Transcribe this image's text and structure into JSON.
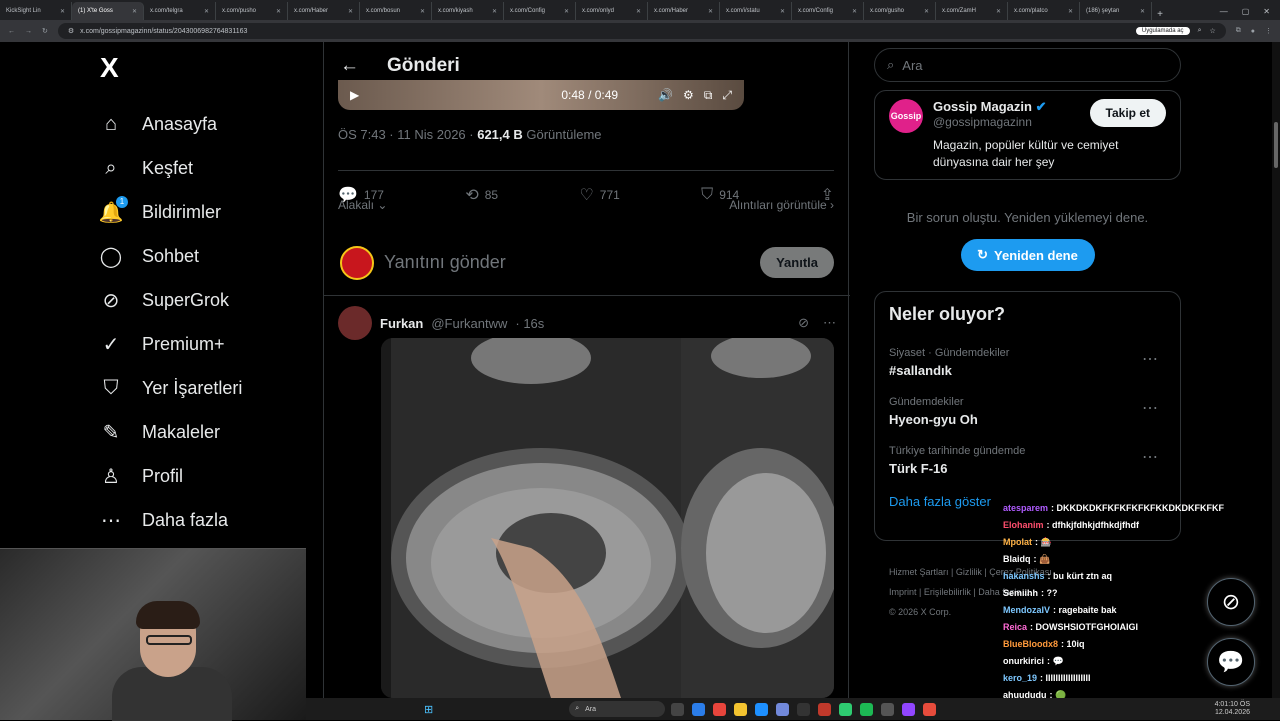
{
  "browser": {
    "tabs": [
      {
        "label": "KickSight Lin",
        "active": false
      },
      {
        "label": "(1) X'te Goss",
        "active": true
      },
      {
        "label": "x.com/telgra",
        "active": false
      },
      {
        "label": "x.com/pusho",
        "active": false
      },
      {
        "label": "x.com/Haber",
        "active": false
      },
      {
        "label": "x.com/bosun",
        "active": false
      },
      {
        "label": "x.com/kiyash",
        "active": false
      },
      {
        "label": "x.com/Config",
        "active": false
      },
      {
        "label": "x.com/onlyd",
        "active": false
      },
      {
        "label": "x.com/Haber",
        "active": false
      },
      {
        "label": "x.com/i/statu",
        "active": false
      },
      {
        "label": "x.com/Config",
        "active": false
      },
      {
        "label": "x.com/gusho",
        "active": false
      },
      {
        "label": "x.com/ZamH",
        "active": false
      },
      {
        "label": "x.com/platco",
        "active": false
      },
      {
        "label": "(186) şeytan",
        "active": false
      }
    ],
    "url": "x.com/gossipmagazinn/status/2043006982764831163",
    "open_in_app": "Uygulamada aç"
  },
  "nav": {
    "logo": "X",
    "items": [
      {
        "label": "Anasayfa",
        "icon": "home-icon",
        "glyph": "⌂"
      },
      {
        "label": "Keşfet",
        "icon": "search-icon",
        "glyph": "⌕"
      },
      {
        "label": "Bildirimler",
        "icon": "bell-icon",
        "glyph": "🔔",
        "badge": "1"
      },
      {
        "label": "Sohbet",
        "icon": "chat-icon",
        "glyph": "◯"
      },
      {
        "label": "SuperGrok",
        "icon": "grok-icon",
        "glyph": "⊘"
      },
      {
        "label": "Premium+",
        "icon": "premium-icon",
        "glyph": "✓"
      },
      {
        "label": "Yer İşaretleri",
        "icon": "bookmark-icon",
        "glyph": "⛉"
      },
      {
        "label": "Makaleler",
        "icon": "articles-icon",
        "glyph": "✎"
      },
      {
        "label": "Profil",
        "icon": "profile-icon",
        "glyph": "♙"
      },
      {
        "label": "Daha fazla",
        "icon": "more-icon",
        "glyph": "⋯"
      }
    ]
  },
  "post": {
    "header": "Gönderi",
    "video_time": "0:48 / 0:49",
    "timestamp": "ÖS 7:43 · 11 Nis 2026 · ",
    "views_count": "621,4 B",
    "views_label": " Görüntüleme",
    "replies": "177",
    "reposts": "85",
    "likes": "771",
    "bookmarks": "914",
    "sort_label": "Alakalı",
    "quotes_label": "Alıntıları görüntüle",
    "reply_placeholder": "Yanıtını gönder",
    "reply_button": "Yanıtla"
  },
  "reply_tweet": {
    "name": "Furkan",
    "handle": "@Furkantww",
    "time": "· 16s"
  },
  "sidebar": {
    "search_placeholder": "Ara",
    "profile": {
      "avatar_text": "Gossip",
      "name": "Gossip Magazin",
      "handle": "@gossipmagazinn",
      "bio": "Magazin, popüler kültür ve cemiyet dünyasına dair her şey",
      "follow_label": "Takip et"
    },
    "error_text": "Bir sorun oluştu. Yeniden yüklemeyi dene.",
    "retry_label": "Yeniden dene",
    "trends_title": "Neler oluyor?",
    "trends": [
      {
        "context": "Siyaset · Gündemdekiler",
        "title": "#sallandık"
      },
      {
        "context": "Gündemdekiler",
        "title": "Hyeon-gyu Oh"
      },
      {
        "context": "Türkiye tarihinde gündemde",
        "title": "Türk F-16"
      }
    ],
    "show_more": "Daha fazla göster",
    "footer": {
      "links": [
        "Hizmet Şartları",
        "Gizlilik",
        "Çerez Politikası",
        "Imprint",
        "Erişilebilirlik",
        "Daha fazla ..."
      ],
      "copyright": "© 2026 X Corp."
    }
  },
  "chat": [
    {
      "user": "atesparem",
      "color": "#b05cff",
      "msg": "DKKDKDKFKFKFKFKFKKDKDKFKFKF"
    },
    {
      "user": "Elohanim",
      "color": "#ff4f6e",
      "msg": "dfhkjfdhkjdfhkdjfhdf"
    },
    {
      "user": "Mpolat",
      "color": "#ffb347",
      "msg": "🎰"
    },
    {
      "user": "Blaidq",
      "color": "#ffffff",
      "msg": "👜"
    },
    {
      "user": "hakanshs",
      "color": "#7ec8ff",
      "msg": "bu kürt ztn aq"
    },
    {
      "user": "Semiihh",
      "color": "#ffffff",
      "msg": "??"
    },
    {
      "user": "MendozaIV",
      "color": "#7ec8ff",
      "msg": "ragebaite bak"
    },
    {
      "user": "Reica",
      "color": "#ff6ad5",
      "msg": "DOWSHSIOTFGHOIAIGI"
    },
    {
      "user": "BlueBloodx8",
      "color": "#ff9a3c",
      "msg": "10iq"
    },
    {
      "user": "onurkirici",
      "color": "#ffffff",
      "msg": "💬"
    },
    {
      "user": "kero_19",
      "color": "#7ec8ff",
      "msg": "IIIIIIIIIIIIIIIIII"
    },
    {
      "user": "ahuududu",
      "color": "#ffffff",
      "msg": "🟢"
    }
  ],
  "taskbar": {
    "search": "Ara",
    "time": "4:01:10 ÖS",
    "date": "12.04.2026"
  },
  "colors": {
    "accent": "#1d9bf0",
    "bg": "#000000",
    "muted": "#71767b"
  }
}
